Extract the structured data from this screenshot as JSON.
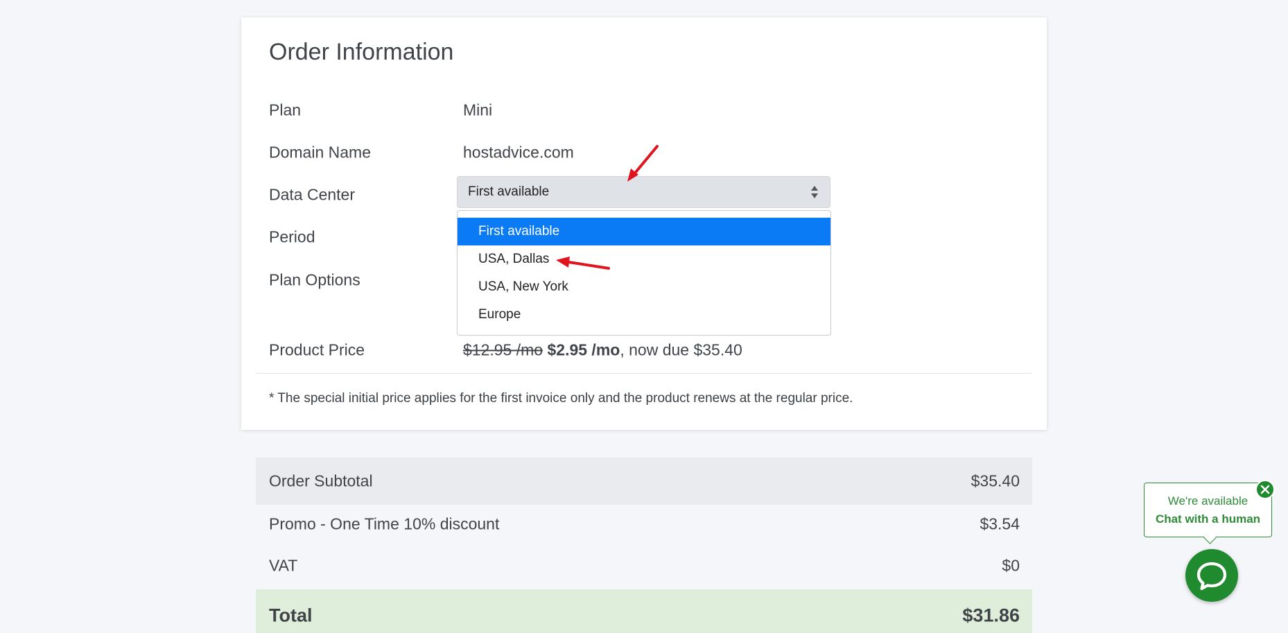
{
  "order": {
    "title": "Order Information",
    "rows": {
      "plan": {
        "label": "Plan",
        "value": "Mini"
      },
      "domain": {
        "label": "Domain Name",
        "value": "hostadvice.com"
      },
      "data_center": {
        "label": "Data Center"
      },
      "period": {
        "label": "Period"
      },
      "plan_options": {
        "label": "Plan Options"
      },
      "price": {
        "label": "Product Price",
        "old_price": "$12.95 /mo",
        "new_price": "$2.95 /mo",
        "due_text": ", now due $35.40"
      }
    },
    "note": "* The special initial price applies for the first invoice only and the product renews at the regular price."
  },
  "data_center_select": {
    "selected": "First available",
    "options": [
      "First available",
      "USA, Dallas",
      "USA, New York",
      "Europe"
    ],
    "highlighted_index": 0
  },
  "summary": {
    "subtotal": {
      "label": "Order Subtotal",
      "value": "$35.40"
    },
    "promo": {
      "label": "Promo - One Time 10% discount",
      "value": "$3.54"
    },
    "vat": {
      "label": "VAT",
      "value": "$0"
    },
    "total": {
      "label": "Total",
      "value": "$31.86"
    }
  },
  "chat": {
    "line1": "We're available",
    "line2": "Chat with a human",
    "icons": {
      "close": "close-icon",
      "chat": "chat-bubble-icon"
    }
  },
  "colors": {
    "highlight": "#0a7bf5",
    "chat_green": "#1f8a2e",
    "total_bg": "#dfeeda",
    "annotation_arrow": "#e0141e"
  }
}
